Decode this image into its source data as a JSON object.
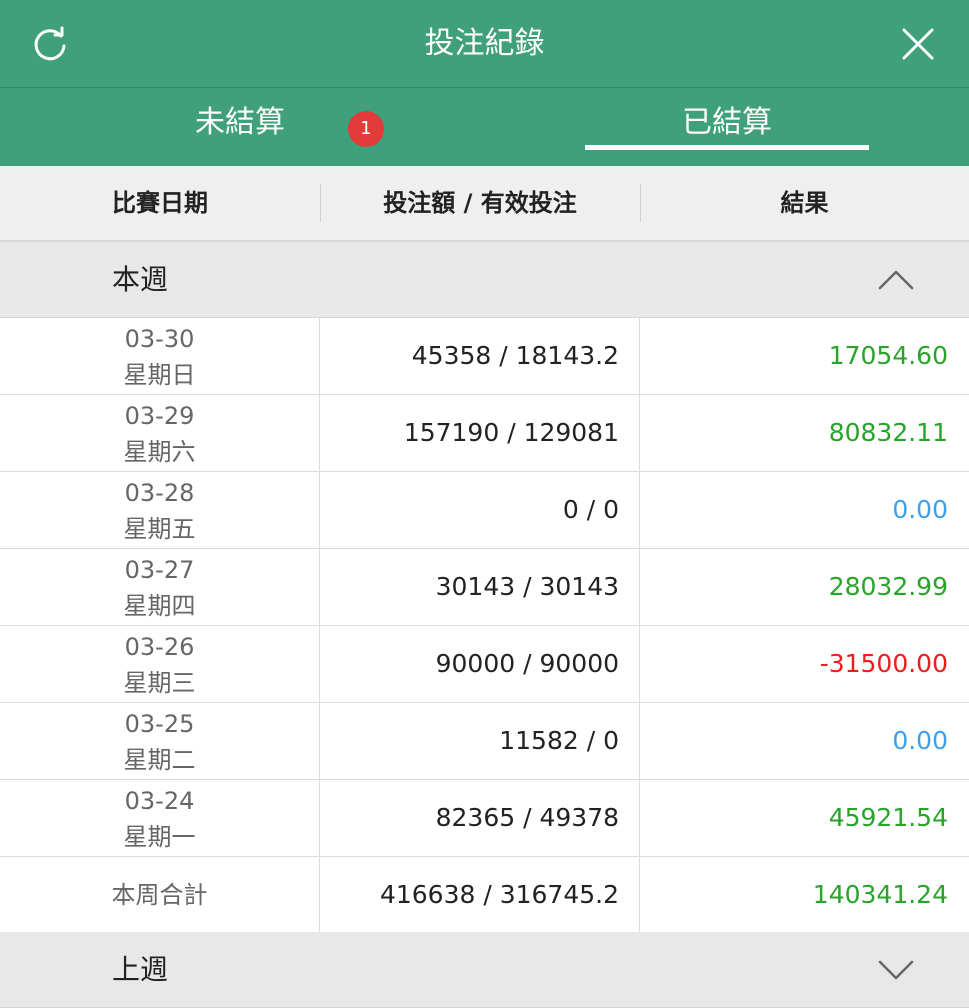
{
  "header": {
    "title": "投注紀錄",
    "refresh_icon": "refresh-icon",
    "close_icon": "close-icon"
  },
  "tabs": [
    {
      "label": "未結算",
      "badge": "1",
      "active": false
    },
    {
      "label": "已結算",
      "active": true
    }
  ],
  "table": {
    "columns": [
      "比賽日期",
      "投注額 / 有效投注",
      "結果"
    ],
    "groups": [
      {
        "name": "本週",
        "expanded": true,
        "rows": [
          {
            "date": "03-30",
            "weekday": "星期日",
            "bet": "45358 / 18143.2",
            "result": "17054.60",
            "status": "pos"
          },
          {
            "date": "03-29",
            "weekday": "星期六",
            "bet": "157190 / 129081",
            "result": "80832.11",
            "status": "pos"
          },
          {
            "date": "03-28",
            "weekday": "星期五",
            "bet": "0 / 0",
            "result": "0.00",
            "status": "zero"
          },
          {
            "date": "03-27",
            "weekday": "星期四",
            "bet": "30143 / 30143",
            "result": "28032.99",
            "status": "pos"
          },
          {
            "date": "03-26",
            "weekday": "星期三",
            "bet": "90000 / 90000",
            "result": "-31500.00",
            "status": "neg"
          },
          {
            "date": "03-25",
            "weekday": "星期二",
            "bet": "11582 / 0",
            "result": "0.00",
            "status": "zero"
          },
          {
            "date": "03-24",
            "weekday": "星期一",
            "bet": "82365 / 49378",
            "result": "45921.54",
            "status": "pos"
          }
        ],
        "total": {
          "label": "本周合計",
          "bet": "416638 / 316745.2",
          "result": "140341.24",
          "status": "pos"
        }
      },
      {
        "name": "上週",
        "expanded": false
      }
    ]
  },
  "colors": {
    "header_green": "#3fa07b",
    "positive": "#2aa32a",
    "zero": "#3ea0e8",
    "negative": "#ee1c1c",
    "badge_red": "#e33a3a"
  }
}
